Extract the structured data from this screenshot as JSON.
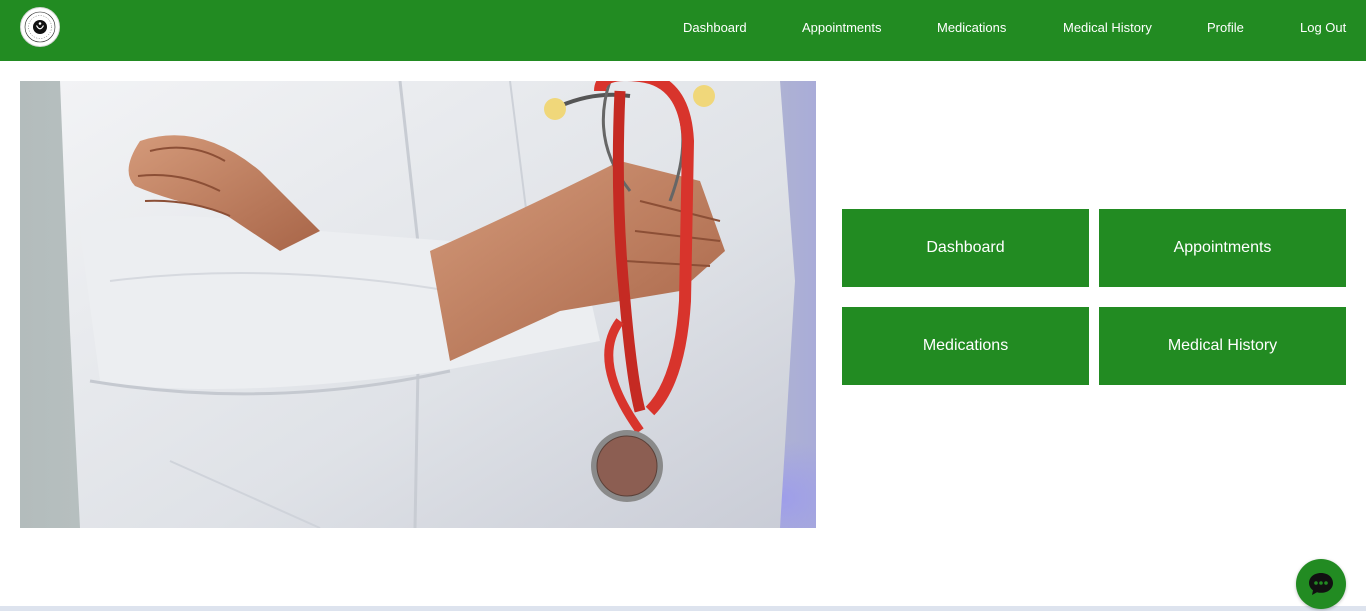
{
  "colors": {
    "brand_green": "#228b22",
    "white": "#ffffff"
  },
  "navbar": {
    "logo_icon": "logo-emblem-icon",
    "links": [
      {
        "label": "Dashboard"
      },
      {
        "label": "Appointments"
      },
      {
        "label": "Medications"
      },
      {
        "label": "Medical History"
      },
      {
        "label": "Profile"
      },
      {
        "label": "Log Out"
      }
    ]
  },
  "hero": {
    "image": "doctor-with-stethoscope-photo"
  },
  "quick_links": [
    {
      "label": "Dashboard"
    },
    {
      "label": "Appointments"
    },
    {
      "label": "Medications"
    },
    {
      "label": "Medical History"
    }
  ],
  "chat": {
    "icon": "chat-bubble-icon"
  }
}
